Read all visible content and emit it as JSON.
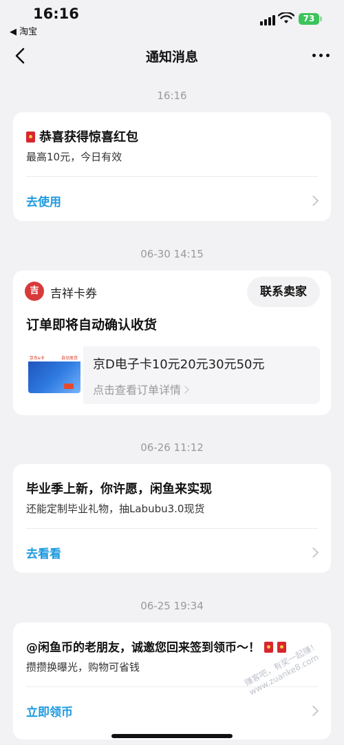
{
  "status": {
    "time": "16:16",
    "back_app": "◀ 淘宝",
    "battery": "73"
  },
  "nav": {
    "title": "通知消息"
  },
  "messages": [
    {
      "timestamp": "16:16",
      "title": "恭喜获得惊喜红包",
      "subtitle": "最高10元，今日有效",
      "action": "去使用"
    },
    {
      "timestamp": "06-30 14:15",
      "shop_logo_text": "吉",
      "shop_name": "吉祥卡券",
      "contact_label": "联系卖家",
      "title": "订单即将自动确认收货",
      "product_title": "京D电子卡10元20元30元50元",
      "product_sub": "点击查看订单详情",
      "card_brand": "京东e卡",
      "card_tag": "自动发货"
    },
    {
      "timestamp": "06-26 11:12",
      "title": "毕业季上新，你许愿，闲鱼来实现",
      "subtitle": "还能定制毕业礼物，抽Labubu3.0现货",
      "action": "去看看"
    },
    {
      "timestamp": "06-25 19:34",
      "title": "@闲鱼币的老朋友，诚邀您回来签到领币～！",
      "subtitle": "攒攒换曝光，购物可省钱",
      "action": "立即领币"
    }
  ],
  "watermark": "赚客吧，有奖一起赚！ www.zuanke8.com",
  "colors": {
    "background": "#f2f2f5",
    "card": "#ffffff",
    "accent_link": "#1e9ae0",
    "timestamp": "#999999",
    "battery": "#3dc35b"
  }
}
